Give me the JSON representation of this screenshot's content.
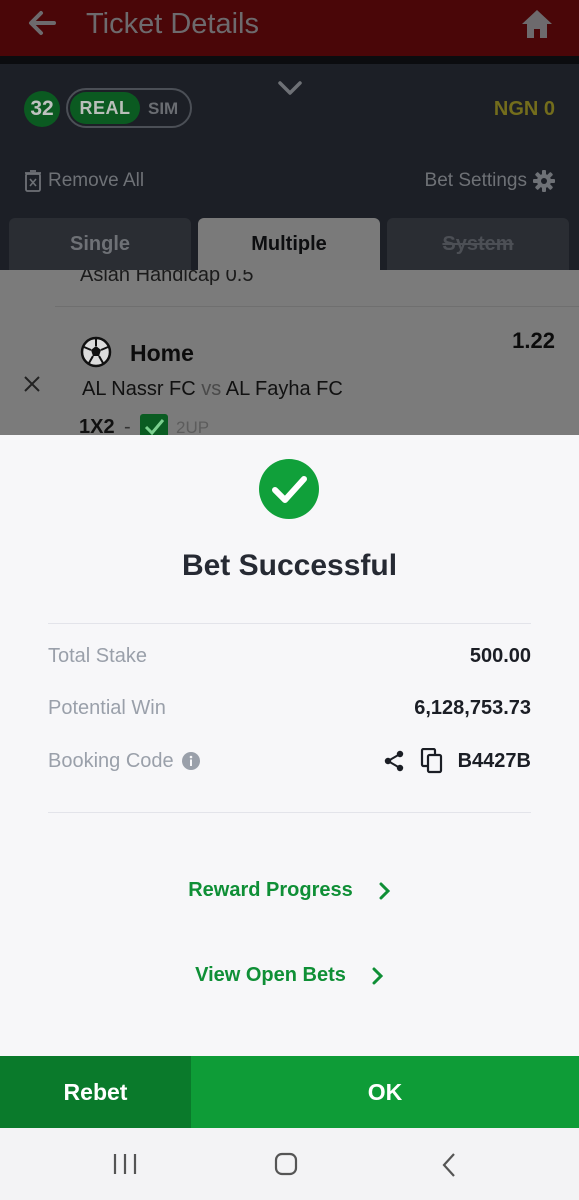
{
  "appbar": {
    "title": "Ticket Details"
  },
  "slip": {
    "count": "32",
    "mode_real": "REAL",
    "mode_sim": "SIM",
    "balance": "NGN 0",
    "remove_all": "Remove All",
    "bet_settings": "Bet Settings",
    "tabs": [
      "Single",
      "Multiple",
      "System"
    ]
  },
  "selection": {
    "prev_market": "Asian Handicap 0.5",
    "pick": "Home",
    "odds": "1.22",
    "home_team": "AL Nassr FC",
    "vs": "vs",
    "away_team": "AL Fayha FC",
    "market": "1X2",
    "dash": "-",
    "boost": "2UP"
  },
  "sheet": {
    "title": "Bet Successful",
    "total_stake_label": "Total Stake",
    "total_stake_value": "500.00",
    "potential_win_label": "Potential Win",
    "potential_win_value": "6,128,753.73",
    "booking_code_label": "Booking Code",
    "booking_code_value": "B4427B",
    "reward_progress": "Reward Progress",
    "view_open_bets": "View Open Bets"
  },
  "actions": {
    "rebet": "Rebet",
    "ok": "OK"
  },
  "colors": {
    "brand_green": "#0e9c37",
    "dark_green": "#0a7a2b",
    "link_green": "#0f8f36"
  },
  "icons": [
    "back-arrow-icon",
    "home-icon",
    "chevron-down-icon",
    "trash-icon",
    "gear-icon",
    "close-icon",
    "soccer-ball-icon",
    "checkbox-icon",
    "success-check-icon",
    "info-icon",
    "share-icon",
    "copy-icon",
    "chevron-right-icon"
  ]
}
